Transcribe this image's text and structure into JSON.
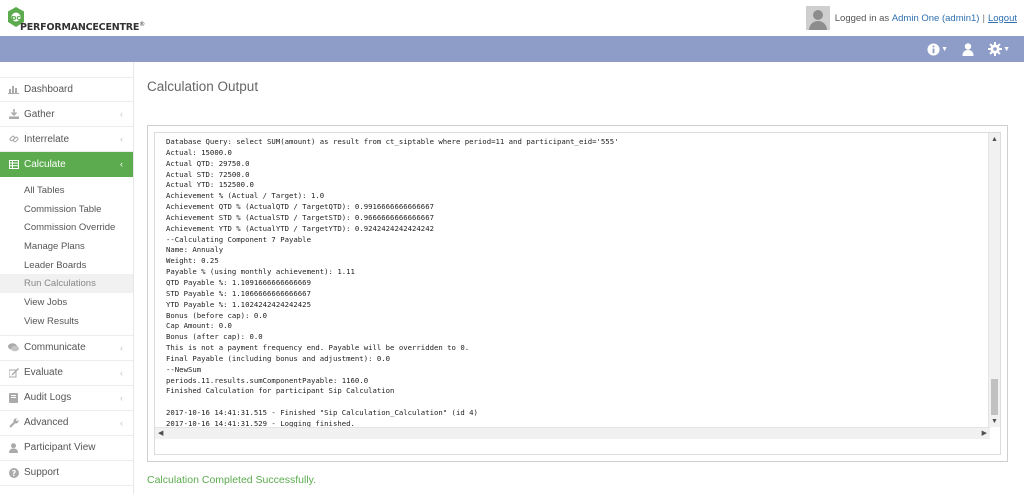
{
  "header": {
    "logo_text": "PERFORMANCECENTRE",
    "logo_sup": "®",
    "logged_in_prefix": "Logged in as ",
    "user_name": "Admin One (admin1)",
    "separator": "|",
    "logout_label": "Logout"
  },
  "navbar": {
    "icons": [
      "info-icon",
      "user-icon",
      "gear-icon"
    ]
  },
  "sidebar": {
    "items": [
      {
        "label": "Dashboard",
        "icon": "bar-chart-icon"
      },
      {
        "label": "Gather",
        "icon": "download-icon"
      },
      {
        "label": "Interrelate",
        "icon": "link-icon"
      },
      {
        "label": "Calculate",
        "icon": "table-icon"
      },
      {
        "label": "Communicate",
        "icon": "comments-icon"
      },
      {
        "label": "Evaluate",
        "icon": "pencil-icon"
      },
      {
        "label": "Audit Logs",
        "icon": "book-icon"
      },
      {
        "label": "Advanced",
        "icon": "wrench-icon"
      },
      {
        "label": "Participant View",
        "icon": "user-icon"
      },
      {
        "label": "Support",
        "icon": "question-icon"
      }
    ],
    "calculate_submenu": [
      "All Tables",
      "Commission Table",
      "Commission Override",
      "Manage Plans",
      "Leader Boards",
      "Run Calculations",
      "View Jobs",
      "View Results"
    ],
    "chevron": "‹"
  },
  "main": {
    "title": "Calculation Output",
    "log_lines": [
      "Database Query: select SUM(amount) as result from ct_siptable where period=11 and participant_eid='555'",
      "Actual: 15000.0",
      "Actual QTD: 29750.0",
      "Actual STD: 72500.0",
      "Actual YTD: 152500.0",
      "Achievement % (Actual / Target): 1.0",
      "Achievement QTD % (ActualQTD / TargetQTD): 0.9916666666666667",
      "Achievement STD % (ActualSTD / TargetSTD): 0.9666666666666667",
      "Achievement YTD % (ActualYTD / TargetYTD): 0.9242424242424242",
      "--Calculating Component 7 Payable",
      "Name: Annualy",
      "Weight: 0.25",
      "Payable % (using monthly achievement): 1.11",
      "QTD Payable %: 1.1091666666666669",
      "STD Payable %: 1.1066666666666667",
      "YTD Payable %: 1.1024242424242425",
      "Bonus (before cap): 0.0",
      "Cap Amount: 0.0",
      "Bonus (after cap): 0.0",
      "This is not a payment frequency end. Payable will be overridden to 0.",
      "Final Payable (including bonus and adjustment): 0.0",
      "--NewSum",
      "periods.11.results.sumComponentPayable: 1160.0",
      "Finished Calculation for participant Sip Calculation",
      "",
      "2017-10-16 14:41:31.515 - Finished \"Sip Calculation_Calculation\" (id 4)",
      "2017-10-16 14:41:31.529 - Logging finished."
    ],
    "status_message": "Calculation Completed Successfully."
  },
  "colors": {
    "navbar": "#8e9dc8",
    "active_green": "#5cab4f",
    "link_blue": "#2f6fb0"
  }
}
